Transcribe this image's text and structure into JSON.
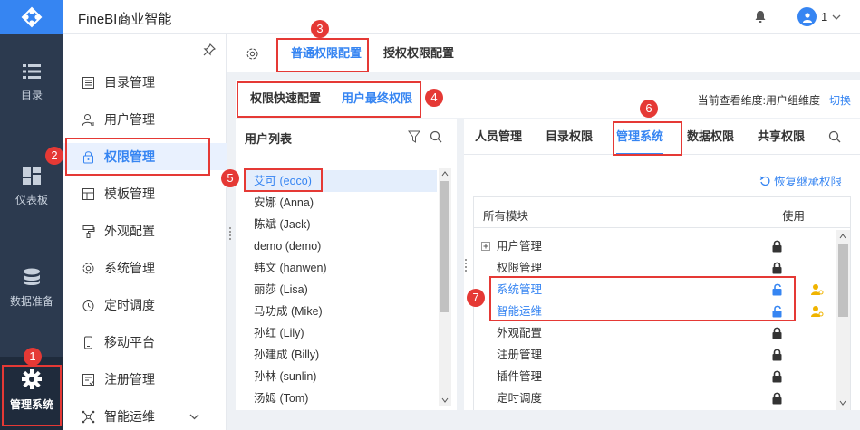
{
  "app": {
    "title": "FineBI商业智能",
    "user": "1"
  },
  "nav": {
    "items": [
      {
        "label": "目录"
      },
      {
        "label": "仪表板"
      },
      {
        "label": "数据准备"
      },
      {
        "label": "管理系统"
      }
    ]
  },
  "menu": {
    "items": [
      {
        "label": "目录管理"
      },
      {
        "label": "用户管理"
      },
      {
        "label": "权限管理"
      },
      {
        "label": "模板管理"
      },
      {
        "label": "外观配置"
      },
      {
        "label": "系统管理"
      },
      {
        "label": "定时调度"
      },
      {
        "label": "移动平台"
      },
      {
        "label": "注册管理"
      },
      {
        "label": "智能运维"
      }
    ]
  },
  "main": {
    "tabs": [
      {
        "label": "普通权限配置"
      },
      {
        "label": "授权权限配置"
      }
    ],
    "subtabs": [
      {
        "label": "权限快速配置"
      },
      {
        "label": "用户最终权限"
      }
    ],
    "dimension": {
      "text": "当前查看维度:用户组维度",
      "switch": "切换"
    }
  },
  "userlist": {
    "title": "用户列表",
    "users": [
      "艾可 (eoco)",
      "安娜 (Anna)",
      "陈斌 (Jack)",
      "demo (demo)",
      "韩文 (hanwen)",
      "丽莎 (Lisa)",
      "马功成 (Mike)",
      "孙红 (Lily)",
      "孙建成 (Billy)",
      "孙林 (sunlin)",
      "汤姆 (Tom)"
    ]
  },
  "rights": {
    "tabs": [
      {
        "label": "人员管理"
      },
      {
        "label": "目录权限"
      },
      {
        "label": "管理系统"
      },
      {
        "label": "数据权限"
      },
      {
        "label": "共享权限"
      }
    ],
    "restore": "恢复继承权限",
    "header": {
      "module": "所有模块",
      "use": "使用"
    },
    "rows": [
      {
        "label": "用户管理"
      },
      {
        "label": "权限管理"
      },
      {
        "label": "系统管理"
      },
      {
        "label": "智能运维"
      },
      {
        "label": "外观配置"
      },
      {
        "label": "注册管理"
      },
      {
        "label": "插件管理"
      },
      {
        "label": "定时调度"
      }
    ]
  },
  "callouts": [
    "1",
    "2",
    "3",
    "4",
    "5",
    "6",
    "7"
  ],
  "colors": {
    "accent": "#3685f2",
    "callout": "#e53935",
    "nav": "#2c3a4f"
  }
}
